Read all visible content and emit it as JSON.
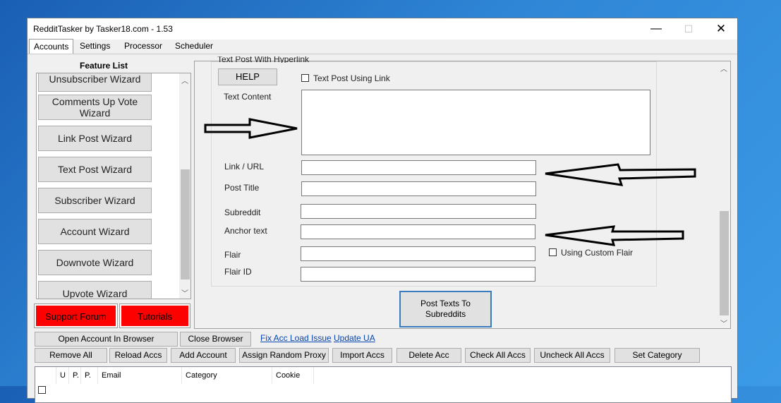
{
  "window": {
    "title": "RedditTasker by Tasker18.com - 1.53",
    "controls": {
      "minimize": "—",
      "maximize": "☐",
      "close": "✕"
    }
  },
  "tabs": [
    "Accounts",
    "Settings",
    "Processor",
    "Scheduler"
  ],
  "sidebar": {
    "heading": "Feature List",
    "items": [
      "Unsubscriber Wizard",
      "Comments Up Vote Wizard",
      "Link Post Wizard",
      "Text Post Wizard",
      "Subscriber Wizard",
      "Account Wizard",
      "Downvote Wizard",
      "Upvote Wizard"
    ],
    "support_label": "Support Forum",
    "tutorials_label": "Tutorials"
  },
  "form": {
    "group_title": "Text Post With Hyperlink",
    "help_label": "HELP",
    "text_post_using_link_label": "Text Post Using Link",
    "text_content_label": "Text Content",
    "link_url_label": "Link / URL",
    "post_title_label": "Post Title",
    "subreddit_label": "Subreddit",
    "anchor_text_label": "Anchor text",
    "flair_label": "Flair",
    "flair_id_label": "Flair ID",
    "custom_flair_label": "Using Custom Flair",
    "post_button_label": "Post Texts To Subreddits"
  },
  "toolbar": {
    "open_browser": "Open Account In Browser",
    "close_browser": "Close Browser",
    "fix_link": "Fix Acc Load Issue",
    "update_link": "Update UA",
    "buttons": [
      "Remove All",
      "Reload Accs",
      "Add Account",
      "Assign Random Proxy",
      "Import Accs",
      "Delete Acc",
      "Check All Accs",
      "Uncheck All Accs",
      "Set Category"
    ]
  },
  "grid": {
    "columns": [
      "U",
      "P.",
      "P.",
      "Email",
      "Category",
      "Cookie"
    ]
  },
  "colors": {
    "red": "#ff0000",
    "link": "#0645ad",
    "post_button_border": "#3a7bbf"
  }
}
